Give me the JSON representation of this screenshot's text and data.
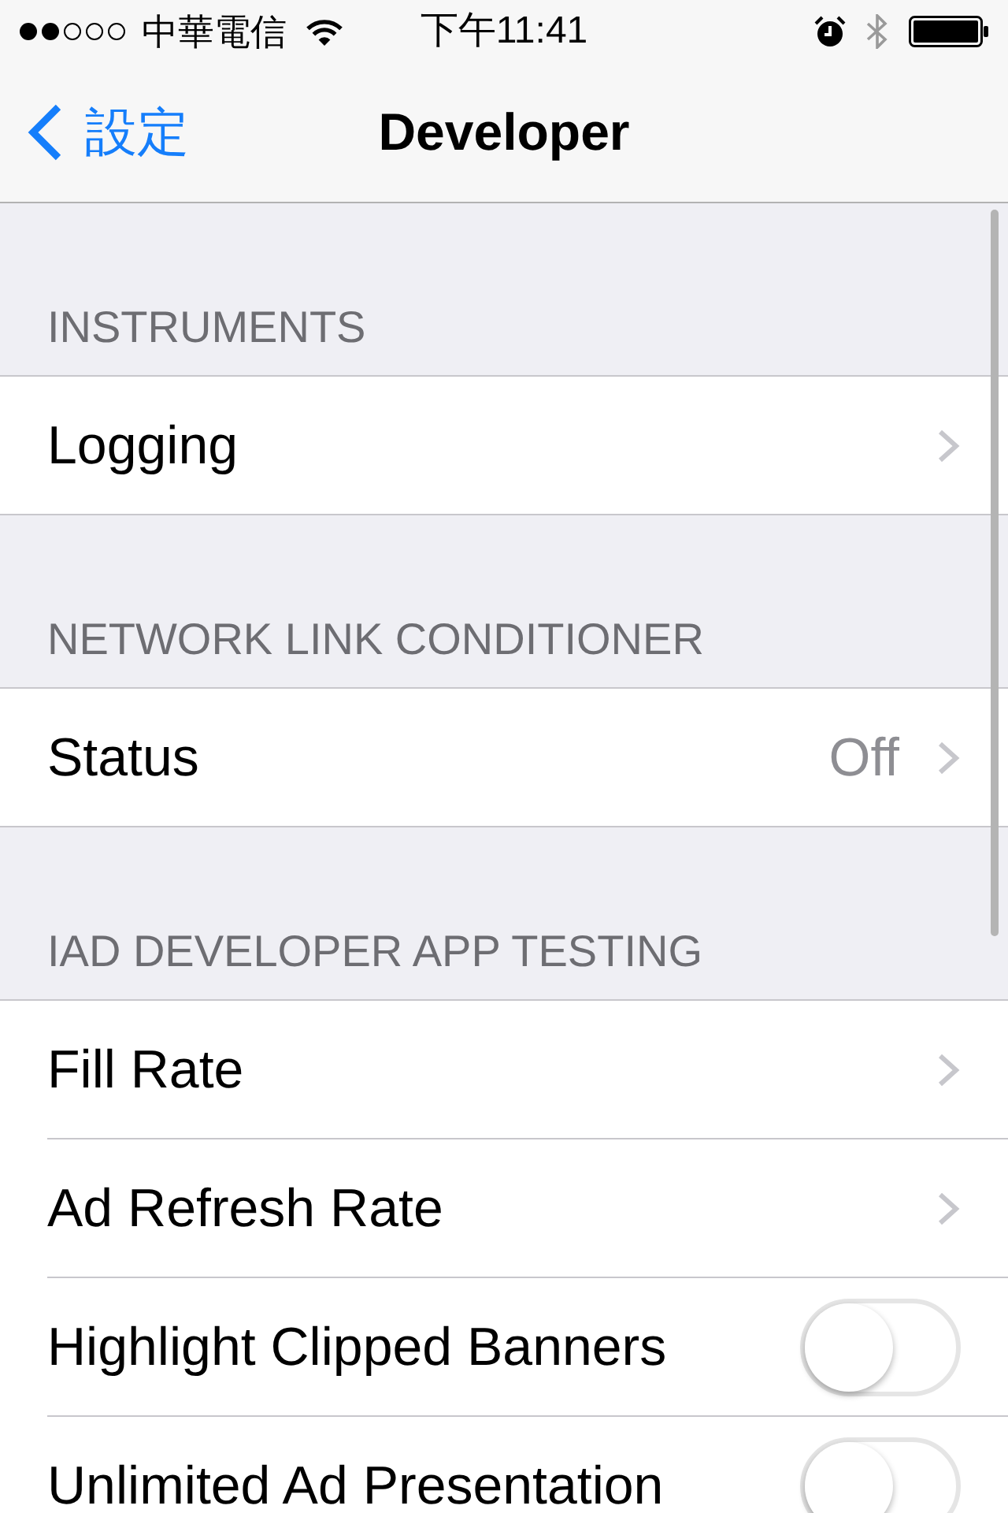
{
  "status_bar": {
    "carrier": "中華電信",
    "time": "下午11:41"
  },
  "nav_bar": {
    "back_label": "設定",
    "title": "Developer"
  },
  "sections": [
    {
      "header": "INSTRUMENTS",
      "rows": [
        {
          "kind": "disclosure",
          "label": "Logging"
        }
      ]
    },
    {
      "header": "NETWORK LINK CONDITIONER",
      "rows": [
        {
          "kind": "disclosure",
          "label": "Status",
          "value": "Off"
        }
      ]
    },
    {
      "header": "IAD DEVELOPER APP TESTING",
      "rows": [
        {
          "kind": "disclosure",
          "label": "Fill Rate"
        },
        {
          "kind": "disclosure",
          "label": "Ad Refresh Rate"
        },
        {
          "kind": "toggle",
          "label": "Highlight Clipped Banners",
          "on": false
        },
        {
          "kind": "toggle",
          "label": "Unlimited Ad Presentation",
          "on": false
        }
      ]
    }
  ]
}
